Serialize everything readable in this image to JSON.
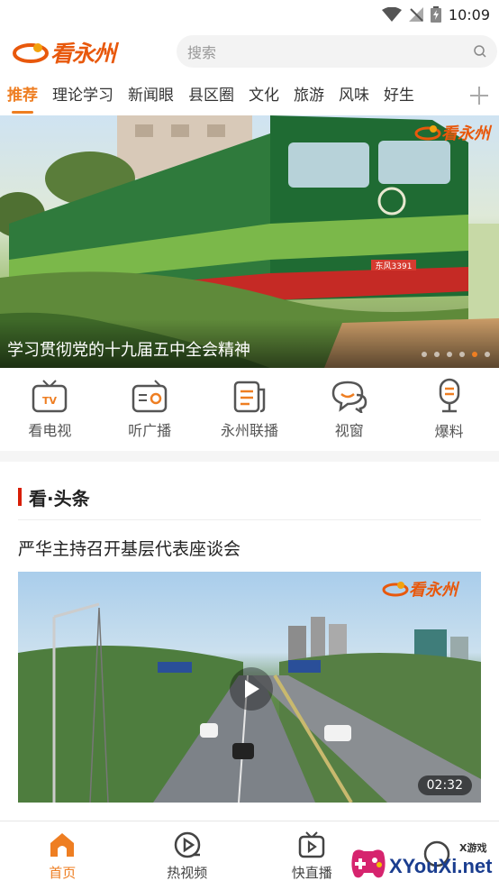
{
  "status_bar": {
    "time": "10:09"
  },
  "header": {
    "logo_text": "看永州",
    "search_placeholder": "搜索"
  },
  "tabs": [
    {
      "label": "推荐",
      "active": true
    },
    {
      "label": "理论学习"
    },
    {
      "label": "新闻眼"
    },
    {
      "label": "县区圈"
    },
    {
      "label": "文化"
    },
    {
      "label": "旅游"
    },
    {
      "label": "风味"
    },
    {
      "label": "好生"
    }
  ],
  "banner": {
    "caption": "学习贯彻党的十九届五中全会精神",
    "watermark": "看永州",
    "train_plate": "东风3391",
    "slide_count": 6,
    "active_slide": 5
  },
  "quick_links": [
    {
      "label": "看电视",
      "icon": "tv-icon"
    },
    {
      "label": "听广播",
      "icon": "radio-icon"
    },
    {
      "label": "永州联播",
      "icon": "news-icon"
    },
    {
      "label": "视窗",
      "icon": "chat-icon"
    },
    {
      "label": "爆料",
      "icon": "microphone-icon"
    }
  ],
  "section": {
    "title": "看·头条"
  },
  "article": {
    "title": "严华主持召开基层代表座谈会",
    "video_duration": "02:32",
    "watermark": "看永州"
  },
  "bottom_nav": [
    {
      "label": "首页",
      "icon": "home-icon",
      "active": true
    },
    {
      "label": "热视频",
      "icon": "play-circle-icon"
    },
    {
      "label": "快直播",
      "icon": "live-tv-icon"
    },
    {
      "label": "",
      "icon": "user-icon"
    }
  ],
  "overlay_watermark": {
    "text": "XYouXi.net",
    "sub": "X游戏"
  },
  "colors": {
    "accent": "#ee7e22",
    "brand": "#e8580c",
    "section_mark": "#d81e06"
  }
}
